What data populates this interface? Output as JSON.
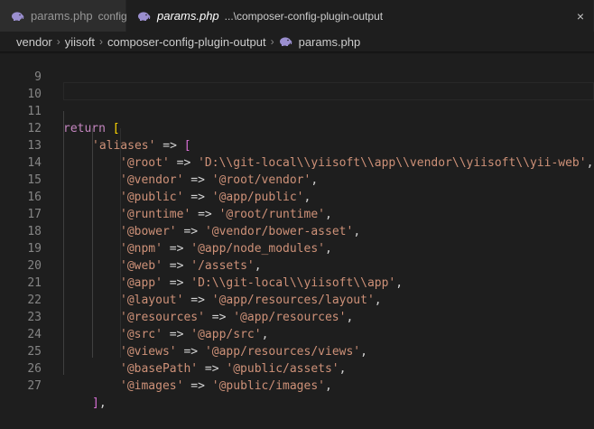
{
  "tabs": [
    {
      "name": "params.php",
      "description": "config",
      "active": false,
      "icon": "php-elephant-icon"
    },
    {
      "name": "params.php",
      "description": "...\\composer-config-plugin-output",
      "active": true,
      "icon": "php-elephant-icon",
      "close": "×"
    }
  ],
  "breadcrumbs": {
    "items": [
      "vendor",
      "yiisoft",
      "composer-config-plugin-output",
      "params.php"
    ],
    "separator": "›"
  },
  "colors": {
    "keyword": "#c586c0",
    "string": "#ce9178",
    "text": "#d4d4d4",
    "bracket_level1": "#ffd700",
    "bracket_level2": "#da70d6",
    "line_number": "#858585",
    "php_icon": "#9b8fd0"
  },
  "editor": {
    "lines": [
      {
        "num": "9"
      },
      {
        "num": "10"
      },
      {
        "num": "11",
        "kw": "return",
        "open": "["
      },
      {
        "num": "12",
        "key": "'aliases'",
        "arrow": "=>",
        "open": "["
      },
      {
        "num": "13",
        "key": "'@root'",
        "arrow": "=>",
        "value": "'D:\\\\git-local\\\\yiisoft\\\\app\\\\vendor\\\\yiisoft\\\\yii-web'",
        "tail": ","
      },
      {
        "num": "14",
        "key": "'@vendor'",
        "arrow": "=>",
        "value": "'@root/vendor'",
        "tail": ","
      },
      {
        "num": "15",
        "key": "'@public'",
        "arrow": "=>",
        "value": "'@app/public'",
        "tail": ","
      },
      {
        "num": "16",
        "key": "'@runtime'",
        "arrow": "=>",
        "value": "'@root/runtime'",
        "tail": ","
      },
      {
        "num": "17",
        "key": "'@bower'",
        "arrow": "=>",
        "value": "'@vendor/bower-asset'",
        "tail": ","
      },
      {
        "num": "18",
        "key": "'@npm'",
        "arrow": "=>",
        "value": "'@app/node_modules'",
        "tail": ","
      },
      {
        "num": "19",
        "key": "'@web'",
        "arrow": "=>",
        "value": "'/assets'",
        "tail": ","
      },
      {
        "num": "20",
        "key": "'@app'",
        "arrow": "=>",
        "value": "'D:\\\\git-local\\\\yiisoft\\\\app'",
        "tail": ","
      },
      {
        "num": "21",
        "key": "'@layout'",
        "arrow": "=>",
        "value": "'@app/resources/layout'",
        "tail": ","
      },
      {
        "num": "22",
        "key": "'@resources'",
        "arrow": "=>",
        "value": "'@app/resources'",
        "tail": ","
      },
      {
        "num": "23",
        "key": "'@src'",
        "arrow": "=>",
        "value": "'@app/src'",
        "tail": ","
      },
      {
        "num": "24",
        "key": "'@views'",
        "arrow": "=>",
        "value": "'@app/resources/views'",
        "tail": ","
      },
      {
        "num": "25",
        "key": "'@basePath'",
        "arrow": "=>",
        "value": "'@public/assets'",
        "tail": ","
      },
      {
        "num": "26",
        "key": "'@images'",
        "arrow": "=>",
        "value": "'@public/images'",
        "tail": ","
      },
      {
        "num": "27",
        "close": "]",
        "tail": ","
      }
    ]
  }
}
